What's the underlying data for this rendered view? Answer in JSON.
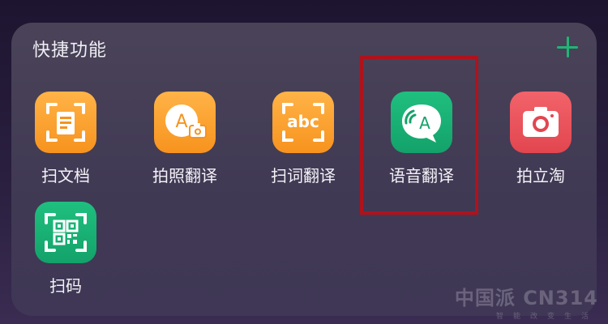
{
  "panel": {
    "title": "快捷功能",
    "add_icon": "plus-icon"
  },
  "apps": [
    {
      "id": "scan-doc",
      "label": "扫文档",
      "icon": "scan-document-icon",
      "color": "#f7931e"
    },
    {
      "id": "photo-translate",
      "label": "拍照翻译",
      "icon": "camera-translate-icon",
      "color": "#f7931e"
    },
    {
      "id": "word-scan-translate",
      "label": "扫词翻译",
      "icon": "abc-scan-icon",
      "color": "#f7931e"
    },
    {
      "id": "voice-translate",
      "label": "语音翻译",
      "icon": "voice-bubble-icon",
      "color": "#13a26a"
    },
    {
      "id": "snap-shop",
      "label": "拍立淘",
      "icon": "camera-icon",
      "color": "#e2464f"
    },
    {
      "id": "scan-code",
      "label": "扫码",
      "icon": "qr-scan-icon",
      "color": "#13a26a"
    }
  ],
  "highlight": {
    "color": "#b0121c",
    "target": "语音翻译"
  },
  "watermark": {
    "main": "中国派 CN314",
    "sub": "智能改变生活"
  }
}
